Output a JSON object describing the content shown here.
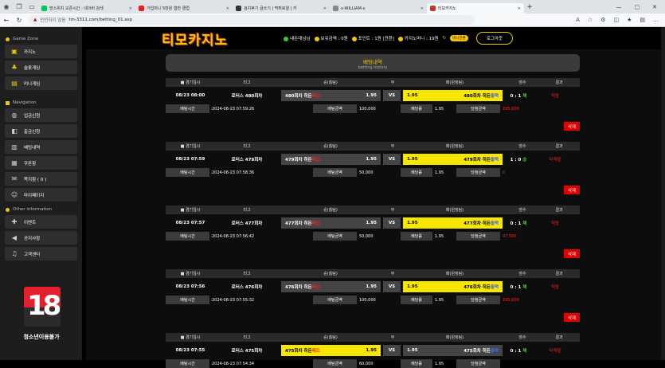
{
  "browser": {
    "tabs": [
      {
        "title": "망스위치 오픈시간 : 네이버 검색",
        "color": "#03c75a",
        "active": false
      },
      {
        "title": "가입머니 5만원 협찬 클럽",
        "color": "#e0211c",
        "active": false
      },
      {
        "title": "검치후기 글쓰기 | 먹튀로얄 | 카",
        "color": "#333",
        "active": false
      },
      {
        "title": "x-WILLIAM-x",
        "color": "#888",
        "active": false
      },
      {
        "title": "티모카지노",
        "color": "#c0392b",
        "active": true
      }
    ],
    "security_label": "안전하지 않음",
    "url": "tm-3311.com/betting_01.asp"
  },
  "header": {
    "logo": "티모카지노",
    "user_name": "내돈대님님",
    "balance_label": "보유금액 : 0원",
    "point_label": "포인트 : 1원 [전환]",
    "casino_money": "카지노머니 : 19원",
    "mini_btn": "미니전환",
    "logout": "로그아웃"
  },
  "sidebar": {
    "game_zone_label": "Game Zone",
    "game_items": [
      {
        "label": "카지노",
        "icon": "casino-icon"
      },
      {
        "label": "슬롯게임",
        "icon": "slot-icon"
      },
      {
        "label": "미니게임",
        "icon": "minigame-icon"
      }
    ],
    "navigation_label": "Navigation",
    "nav_items": [
      {
        "label": "입금신청",
        "icon": "deposit-icon"
      },
      {
        "label": "출금신청",
        "icon": "withdraw-icon"
      },
      {
        "label": "배팅내역",
        "icon": "betting-icon"
      },
      {
        "label": "쿠폰함",
        "icon": "coupon-icon"
      },
      {
        "label": "쪽지함 ( 0 )",
        "icon": "mail-icon"
      },
      {
        "label": "마이페이지",
        "icon": "user-icon"
      }
    ],
    "other_label": "Other information",
    "other_items": [
      {
        "label": "이벤트",
        "icon": "gift-icon"
      },
      {
        "label": "공지사항",
        "icon": "megaphone-icon"
      },
      {
        "label": "고객센터",
        "icon": "headset-icon"
      }
    ],
    "age_badge": "18",
    "age_text": "청소년이용불가"
  },
  "betting": {
    "title": "베팅내역",
    "subtitle": "betting history",
    "headers": [
      "■ 경기일시",
      "리그",
      "승(홈팀)",
      "무",
      "패(원정팀)",
      "점수",
      "결과"
    ],
    "detail_labels": {
      "bet_time": "배팅시간",
      "bet_amount": "배팅금액",
      "odds": "배당률",
      "win_amount": "당첨금액"
    },
    "delete_label": "삭제",
    "rows": [
      {
        "date": "08/23 08:00",
        "league": "로터스 480회차",
        "home": "480회차 히든",
        "home_tag": "레드",
        "home_odds": "1.95",
        "vs": "VS",
        "away_odds": "1.95",
        "away": "480회차 히든",
        "away_tag": "블랙",
        "score": "0 : 1",
        "score_mark": "패",
        "result": "적중",
        "bet_time": "2024-08-23 07:59:26",
        "bet_amount": "100,000",
        "odds": "1.95",
        "win": "195,000",
        "pick": "away"
      },
      {
        "date": "08/23 07:59",
        "league": "로터스 479회차",
        "home": "479회차 히든",
        "home_tag": "레드",
        "home_odds": "1.95",
        "vs": "VS",
        "away_odds": "1.95",
        "away": "479회차 히든",
        "away_tag": "블랙",
        "score": "1 : 0",
        "score_mark": "승",
        "result": "미적중",
        "bet_time": "2024-08-23 07:58:36",
        "bet_amount": "50,000",
        "odds": "1.95",
        "win": "0",
        "pick": "away"
      },
      {
        "date": "08/23 07:57",
        "league": "로터스 477회차",
        "home": "477회차 히든",
        "home_tag": "레드",
        "home_odds": "1.95",
        "vs": "VS",
        "away_odds": "1.95",
        "away": "477회차 히든",
        "away_tag": "블랙",
        "score": "0 : 1",
        "score_mark": "패",
        "result": "적중",
        "bet_time": "2024-08-23 07:56:42",
        "bet_amount": "50,000",
        "odds": "1.95",
        "win": "97,500",
        "pick": "away"
      },
      {
        "date": "08/23 07:56",
        "league": "로터스 476회차",
        "home": "476회차 히든",
        "home_tag": "레드",
        "home_odds": "1.95",
        "vs": "VS",
        "away_odds": "1.95",
        "away": "476회차 히든",
        "away_tag": "블랙",
        "score": "0 : 1",
        "score_mark": "패",
        "result": "적중",
        "bet_time": "2024-08-23 07:55:32",
        "bet_amount": "100,000",
        "odds": "1.95",
        "win": "195,000",
        "pick": "away"
      },
      {
        "date": "08/23 07:55",
        "league": "로터스 475회차",
        "home": "475회차 히든",
        "home_tag": "레드",
        "home_odds": "1.95",
        "vs": "VS",
        "away_odds": "1.95",
        "away": "475회차 히든",
        "away_tag": "블랙",
        "score": "0 : 1",
        "score_mark": "패",
        "result": "미적중",
        "bet_time": "2024-08-23 07:54:34",
        "bet_amount": "60,000",
        "odds": "1.95",
        "win": "",
        "pick": "home"
      }
    ]
  },
  "colors": {
    "accent": "#f3c600",
    "pick": "#f6e600",
    "red": "#ff2020",
    "blue": "#2f6bff"
  }
}
